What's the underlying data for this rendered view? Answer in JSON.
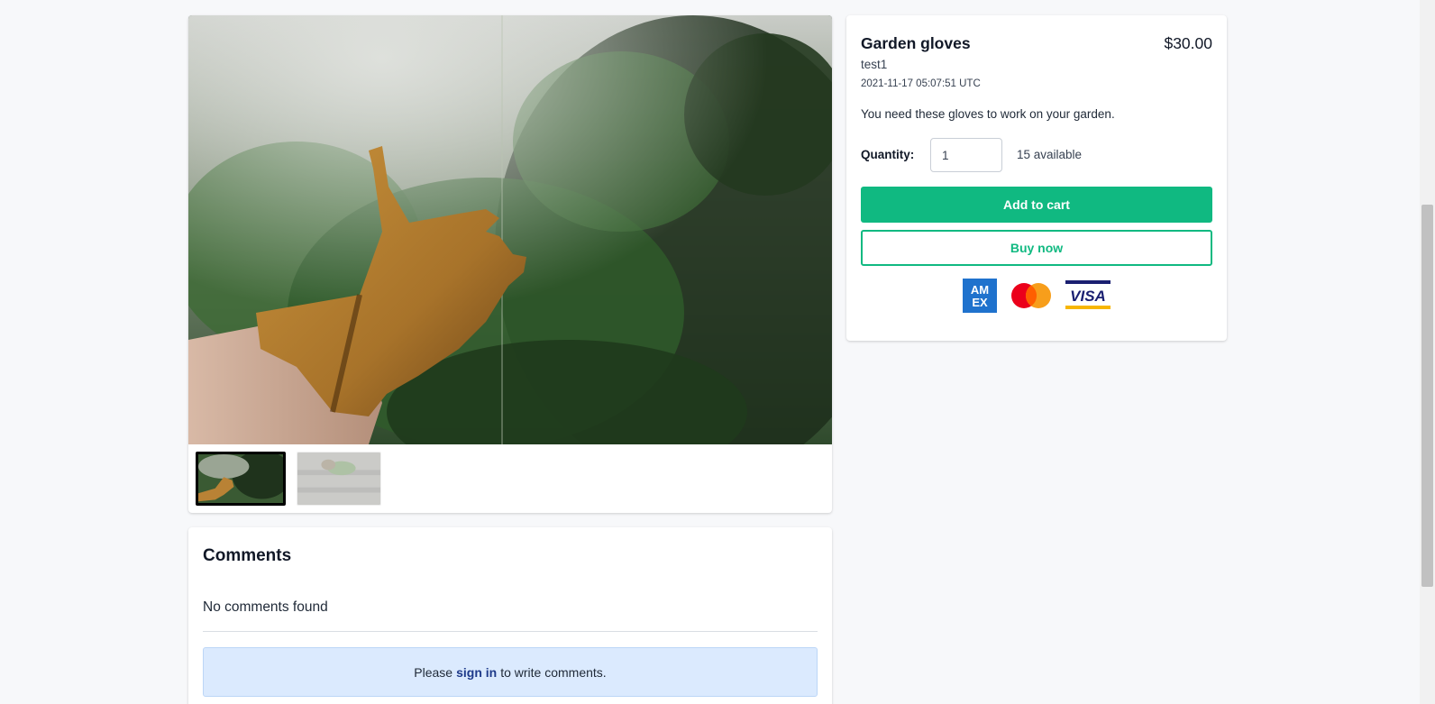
{
  "product": {
    "title": "Garden gloves",
    "price": "$30.00",
    "seller": "test1",
    "timestamp": "2021-11-17 05:07:51 UTC",
    "description": "You need these gloves to work on your garden.",
    "quantity_label": "Quantity:",
    "quantity_value": "1",
    "available": "15 available",
    "add_to_cart_label": "Add to cart",
    "buy_now_label": "Buy now",
    "payment_methods": [
      "amex-icon",
      "mastercard-icon",
      "visa-icon"
    ]
  },
  "gallery": {
    "thumbnails": [
      "gloved-hand-photo",
      "garden-tools-photo"
    ],
    "selected_index": 0
  },
  "comments": {
    "title": "Comments",
    "empty_message": "No comments found",
    "signin_prefix": "Please",
    "signin_link": "sign in",
    "signin_suffix": "to write comments."
  },
  "colors": {
    "accent": "#10b981",
    "alert_bg": "#dbeafe",
    "link": "#1e3a8a"
  }
}
